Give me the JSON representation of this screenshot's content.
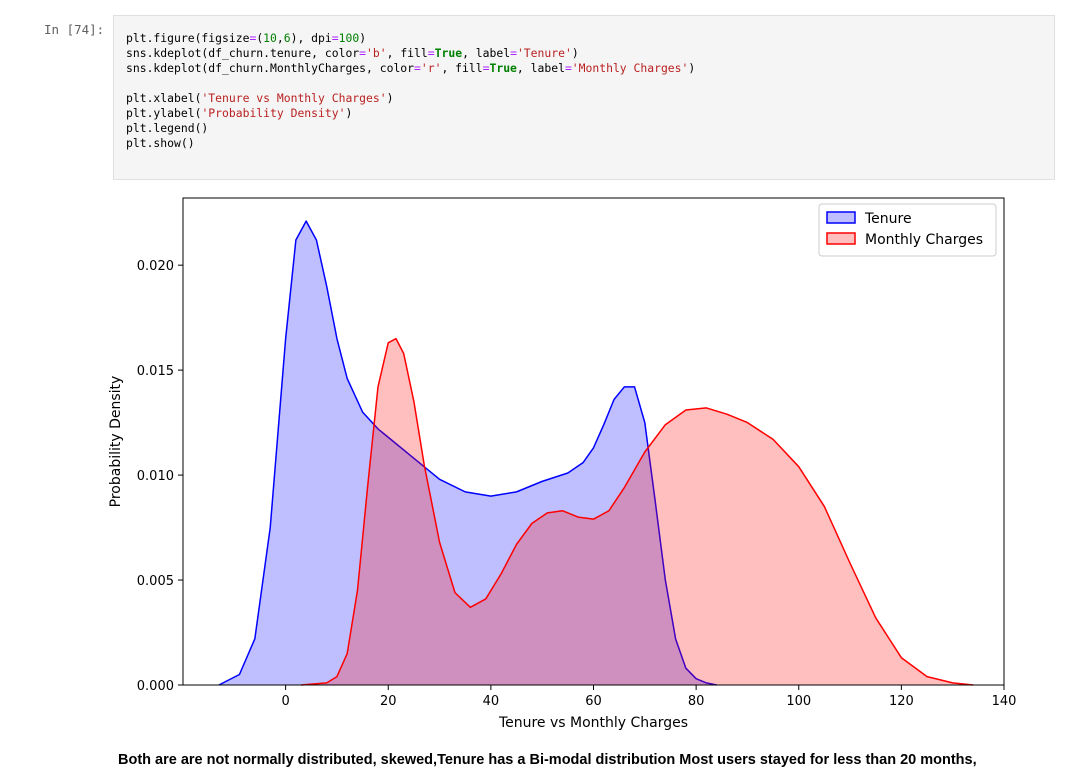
{
  "cell": {
    "prompt": "In [74]:",
    "code_lines": [
      [
        {
          "t": "plt.figure(figsize"
        },
        {
          "t": "=",
          "c": "op"
        },
        {
          "t": "("
        },
        {
          "t": "10",
          "c": "num"
        },
        {
          "t": ","
        },
        {
          "t": "6",
          "c": "num"
        },
        {
          "t": "), dpi"
        },
        {
          "t": "=",
          "c": "op"
        },
        {
          "t": "100",
          "c": "num"
        },
        {
          "t": ")"
        }
      ],
      [
        {
          "t": "sns.kdeplot(df_churn.tenure, color"
        },
        {
          "t": "=",
          "c": "op"
        },
        {
          "t": "'b'",
          "c": "str"
        },
        {
          "t": ", fill"
        },
        {
          "t": "=",
          "c": "op"
        },
        {
          "t": "True",
          "c": "kw"
        },
        {
          "t": ", label"
        },
        {
          "t": "=",
          "c": "op"
        },
        {
          "t": "'Tenure'",
          "c": "str"
        },
        {
          "t": ")"
        }
      ],
      [
        {
          "t": "sns.kdeplot(df_churn.MonthlyCharges, color"
        },
        {
          "t": "=",
          "c": "op"
        },
        {
          "t": "'r'",
          "c": "str"
        },
        {
          "t": ", fill"
        },
        {
          "t": "=",
          "c": "op"
        },
        {
          "t": "True",
          "c": "kw"
        },
        {
          "t": ", label"
        },
        {
          "t": "=",
          "c": "op"
        },
        {
          "t": "'Monthly Charges'",
          "c": "str"
        },
        {
          "t": ")"
        }
      ],
      [],
      [
        {
          "t": "plt.xlabel("
        },
        {
          "t": "'Tenure vs Monthly Charges'",
          "c": "str"
        },
        {
          "t": ")"
        }
      ],
      [
        {
          "t": "plt.ylabel("
        },
        {
          "t": "'Probability Density'",
          "c": "str"
        },
        {
          "t": ")"
        }
      ],
      [
        {
          "t": "plt.legend()"
        }
      ],
      [
        {
          "t": "plt.show()"
        }
      ]
    ]
  },
  "chart_data": {
    "type": "area",
    "xlabel": "Tenure vs Monthly Charges",
    "ylabel": "Probability Density",
    "xlim": [
      -20,
      140
    ],
    "ylim": [
      0,
      0.0232
    ],
    "xticks": [
      0,
      20,
      40,
      60,
      80,
      100,
      120,
      140
    ],
    "yticks": [
      0.0,
      0.005,
      0.01,
      0.015,
      0.02
    ],
    "ytick_labels": [
      "0.000",
      "0.005",
      "0.010",
      "0.015",
      "0.020"
    ],
    "grid": false,
    "legend_position": "top-right",
    "series": [
      {
        "name": "Tenure",
        "color": "#0000ff",
        "x": [
          -13,
          -9,
          -6,
          -3,
          0,
          2,
          4,
          6,
          8,
          10,
          12,
          15,
          18,
          21,
          25,
          30,
          35,
          40,
          45,
          50,
          55,
          58,
          60,
          62,
          64,
          66,
          68,
          70,
          72,
          74,
          76,
          78,
          80,
          82,
          84
        ],
        "values": [
          0.0,
          0.0005,
          0.0022,
          0.0075,
          0.0165,
          0.0212,
          0.0221,
          0.0212,
          0.019,
          0.0165,
          0.0146,
          0.013,
          0.0122,
          0.0116,
          0.0108,
          0.0098,
          0.0092,
          0.009,
          0.0092,
          0.0097,
          0.0101,
          0.0106,
          0.0113,
          0.0124,
          0.0136,
          0.0142,
          0.0142,
          0.0125,
          0.0088,
          0.005,
          0.0022,
          0.0008,
          0.0003,
          0.0001,
          0.0
        ]
      },
      {
        "name": "Monthly Charges",
        "color": "#ff0000",
        "x": [
          3,
          8,
          10,
          12,
          14,
          16,
          18,
          20,
          21.5,
          23,
          25,
          27,
          30,
          33,
          36,
          39,
          42,
          45,
          48,
          51,
          54,
          57,
          60,
          63,
          66,
          70,
          74,
          78,
          82,
          86,
          90,
          95,
          100,
          105,
          110,
          115,
          120,
          125,
          130,
          134
        ],
        "values": [
          0.0,
          0.0001,
          0.0004,
          0.0015,
          0.0045,
          0.0095,
          0.0142,
          0.0163,
          0.0165,
          0.0158,
          0.0135,
          0.0105,
          0.0068,
          0.0044,
          0.0037,
          0.0041,
          0.0053,
          0.0067,
          0.0077,
          0.0082,
          0.0083,
          0.008,
          0.0079,
          0.0083,
          0.0094,
          0.0111,
          0.0124,
          0.0131,
          0.0132,
          0.0129,
          0.0125,
          0.0117,
          0.0104,
          0.0085,
          0.0058,
          0.0032,
          0.0013,
          0.0004,
          0.0001,
          0.0
        ]
      }
    ]
  },
  "note": {
    "text": "Both are are not normally distributed, skewed,Tenure has a Bi-modal distribution Most users stayed for less than 20 months,"
  }
}
